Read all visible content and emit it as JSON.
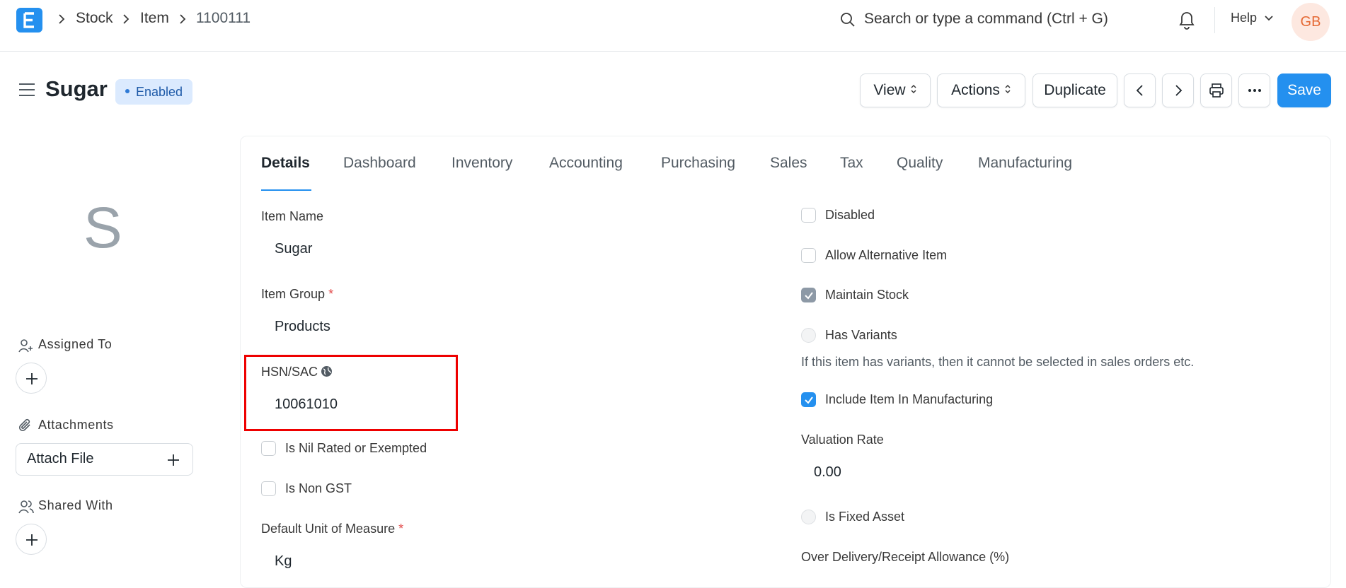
{
  "navbar": {
    "breadcrumbs": [
      "Stock",
      "Item",
      "1100111"
    ],
    "search_placeholder": "Search or type a command (Ctrl + G)",
    "help_label": "Help",
    "avatar_initials": "GB"
  },
  "page": {
    "title": "Sugar",
    "status": "Enabled",
    "buttons": {
      "view": "View",
      "actions": "Actions",
      "duplicate": "Duplicate",
      "save": "Save"
    }
  },
  "sidebar": {
    "image_initial": "S",
    "assigned_to": "Assigned To",
    "attachments": "Attachments",
    "attach_file": "Attach File",
    "shared_with": "Shared With"
  },
  "tabs": [
    "Details",
    "Dashboard",
    "Inventory",
    "Accounting",
    "Purchasing",
    "Sales",
    "Tax",
    "Quality",
    "Manufacturing"
  ],
  "form_left": {
    "item_name_label": "Item Name",
    "item_name_value": "Sugar",
    "item_group_label": "Item Group",
    "item_group_value": "Products",
    "hsn_label": "HSN/SAC",
    "hsn_value": "10061010",
    "nil_rated_label": "Is Nil Rated or Exempted",
    "non_gst_label": "Is Non GST",
    "uom_label": "Default Unit of Measure",
    "uom_value": "Kg",
    "required_mark": "*"
  },
  "form_right": {
    "disabled_label": "Disabled",
    "allow_alt_label": "Allow Alternative Item",
    "maintain_stock_label": "Maintain Stock",
    "has_variants_label": "Has Variants",
    "variants_help": "If this item has variants, then it cannot be selected in sales orders etc.",
    "include_mfg_label": "Include Item In Manufacturing",
    "valuation_rate_label": "Valuation Rate",
    "valuation_rate_value": "0.00",
    "fixed_asset_label": "Is Fixed Asset",
    "over_delivery_label": "Over Delivery/Receipt Allowance (%)"
  },
  "colors": {
    "primary": "#2490ef",
    "highlight_box": "#ee0000",
    "avatar_text": "#e56a35"
  }
}
